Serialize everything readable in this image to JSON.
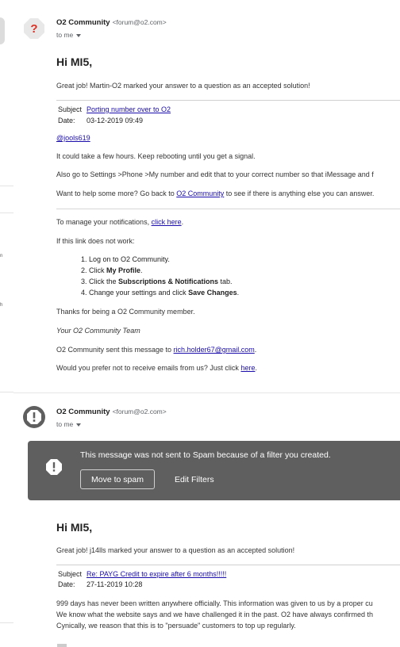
{
  "messages": [
    {
      "sender_name": "O2 Community",
      "sender_email": "<forum@o2.com>",
      "recipient": "to me",
      "greeting": "Hi MI5,",
      "intro": "Great job! Martin-O2 marked your answer to a question as an accepted solution!",
      "subject_label": "Subject",
      "subject": "Porting number over to O2",
      "date_label": "Date:",
      "date": "03-12-2019 09:49",
      "mention": "@jools619",
      "body_1": "It could take a few hours. Keep rebooting until you get a signal.",
      "body_2": "Also go to Settings >Phone >My number and edit that to your correct number so that iMessage and f",
      "help_pre": "Want to help some more? Go back to ",
      "help_link": "O2 Community",
      "help_post": " to see if there is anything else you can answer.",
      "notif_pre": "To manage your notifications, ",
      "notif_link": "click here",
      "notif_post": ".",
      "if_link": "If this link does not work:",
      "steps": [
        {
          "pre": "Log on to O2 Community.",
          "bold": "",
          "post": ""
        },
        {
          "pre": "Click ",
          "bold": "My Profile",
          "post": "."
        },
        {
          "pre": "Click the ",
          "bold": "Subscriptions & Notifications",
          "post": " tab."
        },
        {
          "pre": "Change your settings and click ",
          "bold": "Save Changes",
          "post": "."
        }
      ],
      "thanks": "Thanks for being a O2 Community member.",
      "team": "Your O2 Community Team",
      "sent_pre": "O2 Community sent this message to ",
      "sent_email": "rich.holder67@gmail.com",
      "sent_post": ".",
      "unsub_pre": "Would you prefer not to receive emails from us? Just click ",
      "unsub_link": "here",
      "unsub_post": "."
    },
    {
      "sender_name": "O2 Community",
      "sender_email": "<forum@o2.com>",
      "recipient": "to me",
      "greeting": "Hi MI5,",
      "intro": "Great job! j14lls marked your answer to a question as an accepted solution!",
      "subject_label": "Subject",
      "subject": "Re: PAYG Credit to expire after 6 months!!!!!",
      "date_label": "Date:",
      "date": "27-11-2019 10:28",
      "body_1": "999 days has never been written anywhere officially. This information was given to us by a proper cu",
      "body_2": "We know what the website says and we have challenged it in the past. O2 have always confirmed th",
      "body_3": "Cynically, we reason that this is to \"persuade\" customers to top up regularly."
    }
  ],
  "spam_banner": {
    "text": "This message was not sent to Spam because of a filter you created.",
    "move_button": "Move to spam",
    "filters_button": "Edit Filters"
  },
  "left_strip": {
    "text_1": "n",
    "text_2": "h"
  },
  "colors": {
    "link": "#1a0dab",
    "banner": "#5f5f5f",
    "avatar_first": "#e8e8e8",
    "avatar_second": "#5f5f5f",
    "question_mark": "#d93025"
  },
  "icons": [
    "question-mark-icon",
    "alert-icon",
    "dropdown-caret-icon"
  ]
}
